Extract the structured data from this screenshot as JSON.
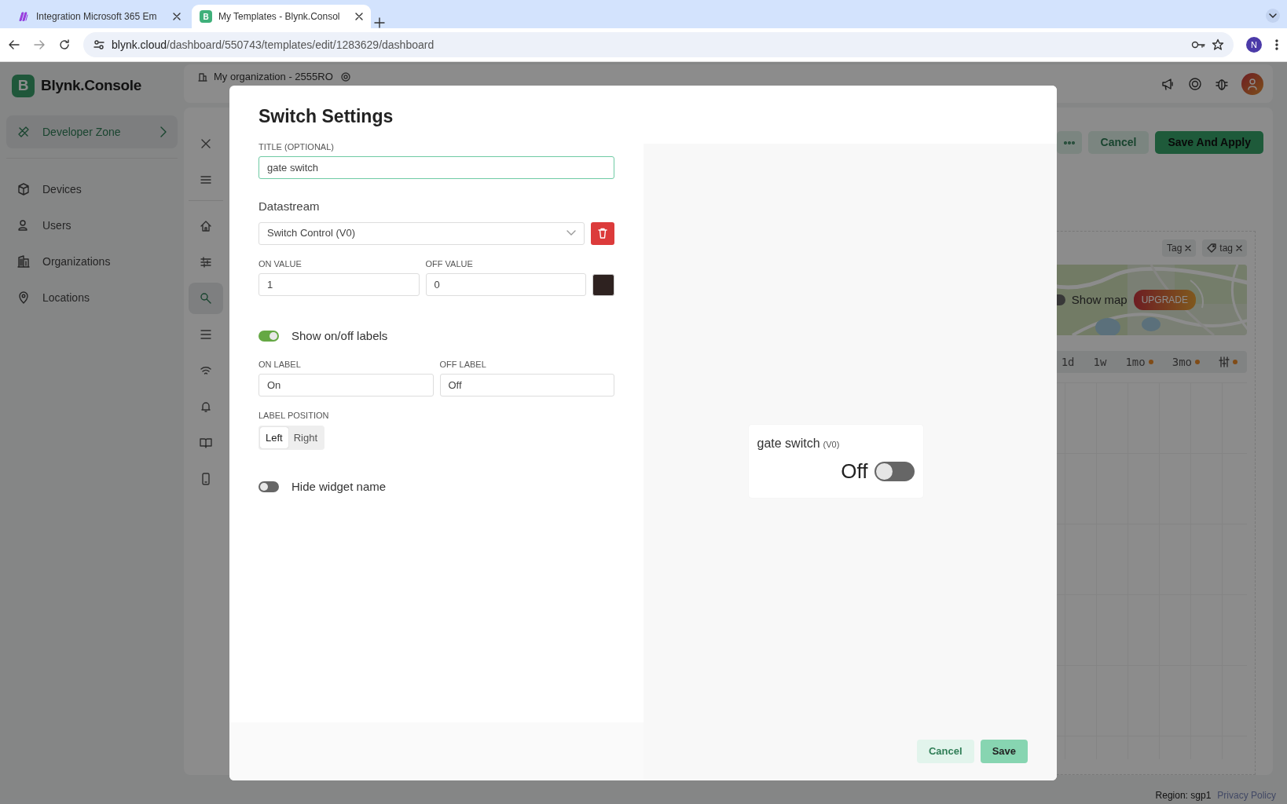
{
  "browser": {
    "tabs": [
      {
        "title": "Integration Microsoft 365 Em",
        "selected": false,
        "kind": "m"
      },
      {
        "title": "My Templates - Blynk.Consol",
        "selected": true,
        "kind": "b",
        "icon_letter": "B"
      }
    ],
    "url_host": "blynk.cloud",
    "url_path": "/dashboard/550743/templates/edit/1283629/dashboard",
    "profile_letter": "N"
  },
  "app": {
    "logo_letter": "B",
    "logo_text": "Blynk.Console",
    "nav": [
      {
        "label": "Developer Zone",
        "selected": true,
        "kind": "tools"
      },
      {
        "label": "Devices",
        "selected": false,
        "kind": "cube"
      },
      {
        "label": "Users",
        "selected": false,
        "kind": "users"
      },
      {
        "label": "Organizations",
        "selected": false,
        "kind": "building"
      },
      {
        "label": "Locations",
        "selected": false,
        "kind": "pin"
      }
    ],
    "org": "My organization - 2555RO",
    "rail": [
      {
        "kind": "home",
        "selected": false
      },
      {
        "kind": "streams",
        "selected": false
      },
      {
        "kind": "search",
        "selected": true
      },
      {
        "kind": "list",
        "selected": false
      },
      {
        "kind": "wifi",
        "selected": false
      },
      {
        "kind": "bell",
        "selected": false
      },
      {
        "kind": "book",
        "selected": false
      },
      {
        "kind": "phone",
        "selected": false
      }
    ],
    "toolbar": {
      "cancel": "Cancel",
      "apply": "Save And Apply"
    },
    "tags": [
      {
        "label": "Tag",
        "kind": "plain"
      },
      {
        "label": "tag",
        "kind": "icon"
      }
    ],
    "map": {
      "toggle_label": "Show map",
      "on": false,
      "badge": "UPGRADE"
    },
    "ranges": [
      {
        "label": "1d",
        "locked": false
      },
      {
        "label": "1w",
        "locked": false
      },
      {
        "label": "1mo",
        "locked": true
      },
      {
        "label": "3mo",
        "locked": true
      }
    ],
    "filter_locked": true,
    "footer": {
      "region": "Region: sgp1",
      "privacy": "Privacy Policy"
    }
  },
  "modal": {
    "title": "Switch Settings",
    "title_field": {
      "label": "TITLE (OPTIONAL)",
      "value": "gate switch"
    },
    "datastream": {
      "heading": "Datastream",
      "value": "Switch Control (V0)"
    },
    "on_value": {
      "label": "ON VALUE",
      "value": "1"
    },
    "off_value": {
      "label": "OFF VALUE",
      "value": "0"
    },
    "color_picker": {
      "color": "#2e2220"
    },
    "show_labels": {
      "label": "Show on/off labels",
      "on": true
    },
    "on_label": {
      "label": "ON LABEL",
      "value": "On"
    },
    "off_label": {
      "label": "OFF LABEL",
      "value": "Off"
    },
    "label_position": {
      "label": "LABEL POSITION",
      "options": [
        {
          "label": "Left",
          "selected": true
        },
        {
          "label": "Right",
          "selected": false
        }
      ]
    },
    "hide_name": {
      "label": "Hide widget name",
      "on": false
    },
    "preview": {
      "title": "gate switch",
      "pin": "(V0)",
      "state_label": "Off",
      "on": false
    },
    "buttons": [
      {
        "label": "Cancel",
        "kind": "secondary"
      },
      {
        "label": "Save",
        "kind": "primary"
      }
    ]
  }
}
